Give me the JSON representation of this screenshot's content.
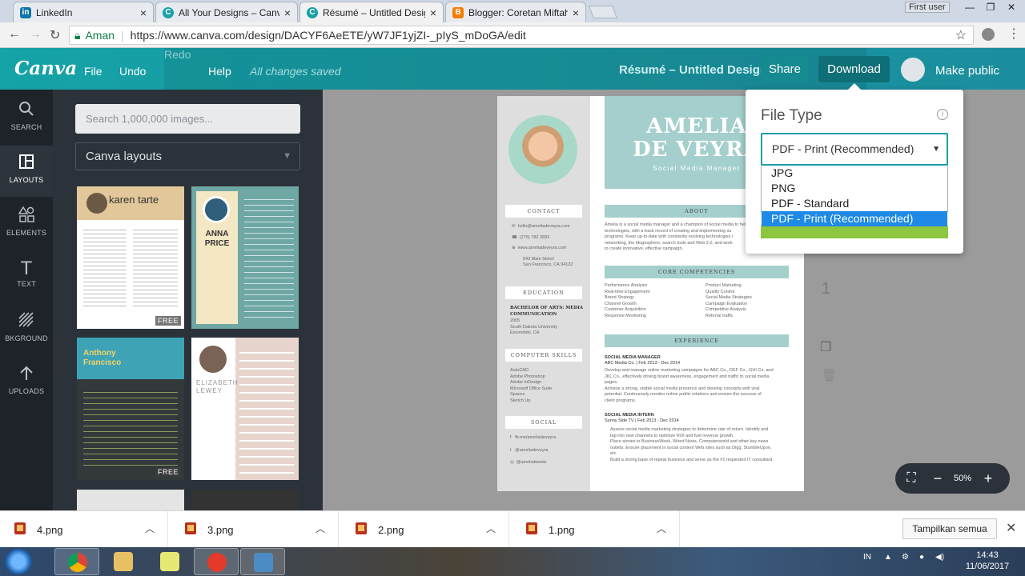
{
  "browser": {
    "tabs": [
      {
        "title": "LinkedIn",
        "icon": "linkedin-icon",
        "color": "#0e76a8"
      },
      {
        "title": "All Your Designs – Canva",
        "icon": "canva-icon",
        "color": "#1aa0a5"
      },
      {
        "title": "Résumé – Untitled Design",
        "icon": "canva-icon",
        "color": "#1aa0a5"
      },
      {
        "title": "Blogger: Coretan Miftahul Jannah",
        "icon": "blogger-icon",
        "color": "#f57d00"
      }
    ],
    "user": "First user",
    "secure_label": "Aman",
    "url": "https://www.canva.com/design/DACYF6AeETE/yW7JF1yjZI-_pIyS_mDoGA/edit"
  },
  "canva": {
    "logo": "Canva",
    "menu": {
      "file": "File",
      "undo": "Undo",
      "redo": "Redo",
      "help": "Help"
    },
    "status": "All changes saved",
    "design_title": "Résumé – Untitled Design",
    "share": "Share",
    "download": "Download",
    "make_public": "Make public",
    "brand_color": "#1aa0a5"
  },
  "sidebar": {
    "items": [
      {
        "label": "SEARCH",
        "icon": "search-icon"
      },
      {
        "label": "LAYOUTS",
        "icon": "layouts-icon"
      },
      {
        "label": "ELEMENTS",
        "icon": "elements-icon"
      },
      {
        "label": "TEXT",
        "icon": "text-icon"
      },
      {
        "label": "BKGROUND",
        "icon": "background-icon"
      },
      {
        "label": "UPLOADS",
        "icon": "upload-icon"
      }
    ]
  },
  "panel": {
    "search_placeholder": "Search 1,000,000 images...",
    "layout_select": "Canva layouts",
    "thumbs": [
      {
        "name": "karen tarte",
        "badge": "FREE"
      },
      {
        "name": "ANNA PRICE",
        "badge": ""
      },
      {
        "name": "Anthony Francisco",
        "badge": "FREE"
      },
      {
        "name": "ELIZABETH LEWEY",
        "badge": ""
      }
    ]
  },
  "resume": {
    "name_line1": "AMELIA",
    "name_line2": "DE VEYRA",
    "role": "Social Media Manager",
    "contact_h": "CONTACT",
    "contact": [
      "hello@ameliadeveyra.com",
      "(275) 782 2893",
      "www.ameliadeveyra.com",
      "543 Main Street",
      "San Francisco, CA 94122"
    ],
    "education_h": "EDUCATION",
    "edu_degree": "BACHELOR OF ARTS: MEDIA COMMUNICATION",
    "edu_year": "2005",
    "edu_school": "South Dakota University",
    "edu_city": "Escondido, CA",
    "skills_h": "COMPUTER SKILLS",
    "skills": [
      "AutoCAD",
      "Adobe Photoshop",
      "Adobe InDesign",
      "Microsoft Office Suite",
      "Spaces",
      "Sketch Up"
    ],
    "social_h": "SOCIAL",
    "social": [
      "fb.me/ameliadeveyra",
      "@ameliadeveyra",
      "@ameliatweets"
    ],
    "about_h": "ABOUT",
    "about": [
      "Amelia is a social media manager and a champion of social media to help",
      "technologies, with a track record of creating and implementing su",
      "programs. Keep up-to-date with constantly evolving technologies i",
      "networking, the blogosphere, search tools and Web 2.0, and work",
      "to create innovative, effective campaign."
    ],
    "core_h": "CORE COMPETENCIES",
    "core_left": [
      "Performance Analysis",
      "Real-time Engagement",
      "Brand Strategy",
      "Channel Growth",
      "Customer Acquisition",
      "Response Monitoring"
    ],
    "core_right": [
      "Product Marketing",
      "Quality Control",
      "Social Media Strategies",
      "Campaign Evaluation",
      "Competitive Analysis",
      "Referral traffic"
    ],
    "exp_h": "EXPERIENCE",
    "job1_title": "SOCIAL MEDIA MANAGER",
    "job1_meta": "ABC Media Co. | Feb 2013 - Dec 2014",
    "job1_desc": [
      "Develop and manage online marketing campaigns for ABC Co., DEF Co., GHI Co. and",
      "JKL Co., effectively driving brand awareness, engagement and traffic to social media",
      "pages.",
      "Achieve a strong, visible social media presence and develop concepts with viral",
      "potential. Continuously monitor online public relations and ensure the success of",
      "client programs."
    ],
    "job2_title": "SOCIAL MEDIA INTERN",
    "job2_meta": "Sunny Side TV | Feb 2013 - Dec 2014",
    "job2_bullets": [
      "Assess social media marketing strategies to determine rate of return. Identify and",
      "tap into new channels to optimize ROI and fuel revenue growth.",
      "Place stories in BusinessWeek, Wired News, Computerworld and other key news",
      "outlets. Ensure placement in social content Web sites such as Digg, StumbleUpon,",
      "etc.",
      "Build a strong base of repeat business and serve as the #1 requested IT consultant."
    ]
  },
  "page_number": "1",
  "zoom_level": "50%",
  "download_panel": {
    "title": "File Type",
    "selected": "PDF - Print (Recommended)",
    "options": [
      "JPG",
      "PNG",
      "PDF - Standard",
      "PDF - Print (Recommended)"
    ]
  },
  "downloads_bar": {
    "files": [
      "4.png",
      "3.png",
      "2.png",
      "1.png"
    ],
    "show_all": "Tampilkan semua"
  },
  "taskbar": {
    "lang": "IN",
    "time": "14:43",
    "date": "11/06/2017"
  }
}
